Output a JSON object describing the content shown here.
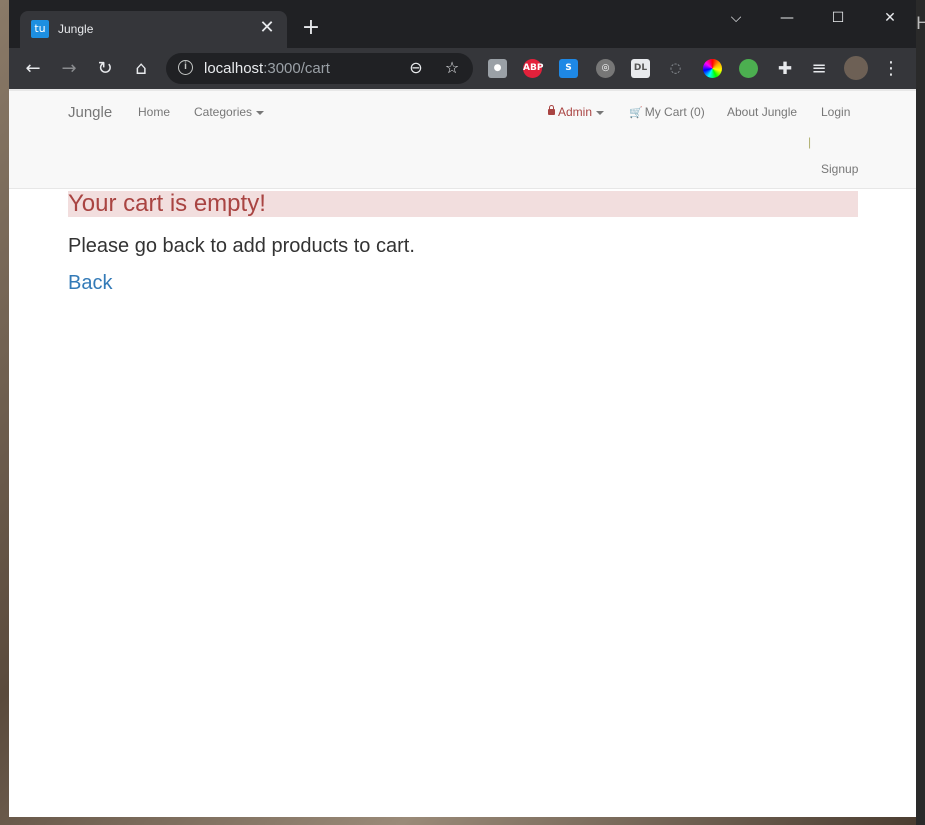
{
  "tabbar": {
    "tab_title": "Jungle",
    "favicon_text": "tu",
    "close_glyph": "✕",
    "new_tab_glyph": "+",
    "controls": {
      "list_tabs": "⌵",
      "minimize": "—",
      "maximize": "☐",
      "close": "✕"
    }
  },
  "toolbar": {
    "back_glyph": "←",
    "forward_glyph": "→",
    "reload_glyph": "↻",
    "home_glyph": "⌂",
    "url_host": "localhost",
    "url_path": ":3000/cart",
    "zoom_glyph": "⊖",
    "star_glyph": "☆",
    "extensions": [
      {
        "name": "extension-icon-1",
        "label": "",
        "color": "#9aa0a6"
      },
      {
        "name": "adblock-plus-icon",
        "label": "ABP",
        "color": "#e3213b"
      },
      {
        "name": "extension-s-icon",
        "label": "S",
        "color": "#1e88e5"
      },
      {
        "name": "extension-circle-icon",
        "label": "",
        "color": "#777"
      },
      {
        "name": "zoom-dl-icon",
        "label": "DL",
        "color": "#e8eaed"
      },
      {
        "name": "extension-mouse-icon",
        "label": "",
        "color": "#35363a"
      },
      {
        "name": "color-wheel-icon",
        "label": "",
        "color": "#35363a"
      },
      {
        "name": "frog-icon",
        "label": "",
        "color": "#35363a"
      }
    ],
    "puzzle_glyph": "✚",
    "media_glyph": "≡",
    "menu_glyph": "⋮"
  },
  "nav": {
    "brand": "Jungle",
    "home": "Home",
    "categories": "Categories",
    "admin": "Admin",
    "cart": "My Cart (0)",
    "about": "About Jungle",
    "login": "Login",
    "divider": "|",
    "signup": "Signup"
  },
  "main": {
    "alert": "Your cart is empty!",
    "message": "Please go back to add products to cart.",
    "back": "Back"
  },
  "colors": {
    "alert_bg": "#f2dede",
    "alert_text": "#a94442",
    "link": "#337ab7"
  }
}
